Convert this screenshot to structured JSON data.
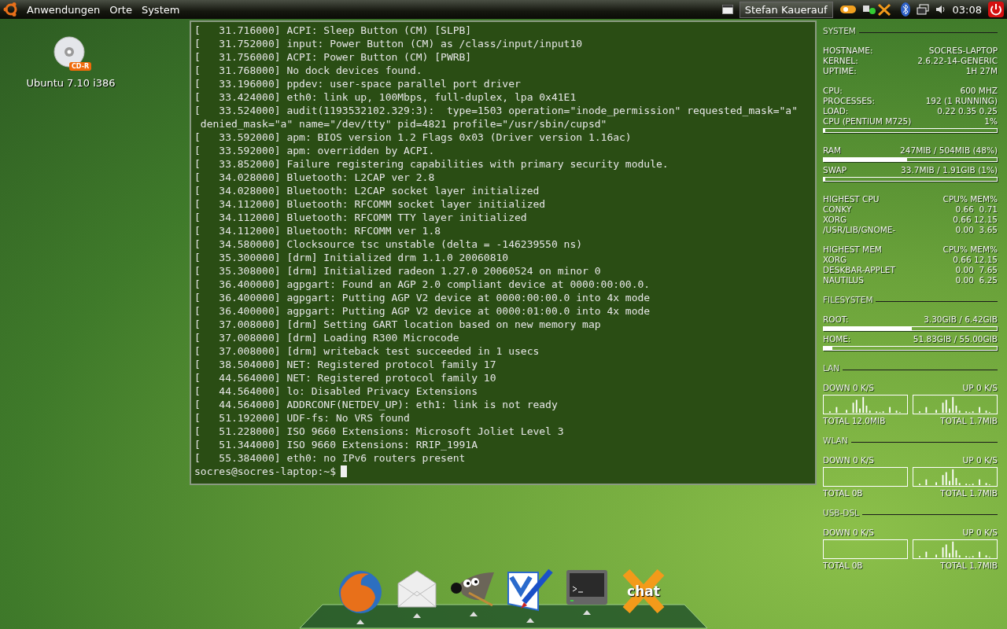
{
  "top_panel": {
    "menus": [
      "Anwendungen",
      "Orte",
      "System"
    ],
    "user": "Stefan Kauerauf",
    "clock": "03:08"
  },
  "desktop_icons": [
    {
      "label": "Ubuntu 7.10 i386",
      "badge": "CD-R"
    }
  ],
  "terminal": {
    "lines": [
      "[   31.716000] ACPI: Sleep Button (CM) [SLPB]",
      "[   31.752000] input: Power Button (CM) as /class/input/input10",
      "[   31.756000] ACPI: Power Button (CM) [PWRB]",
      "[   31.768000] No dock devices found.",
      "[   33.196000] ppdev: user-space parallel port driver",
      "[   33.424000] eth0: link up, 100Mbps, full-duplex, lpa 0x41E1",
      "[   33.524000] audit(1193532102.329:3):  type=1503 operation=\"inode_permission\" requested_mask=\"a\"",
      " denied_mask=\"a\" name=\"/dev/tty\" pid=4821 profile=\"/usr/sbin/cupsd\"",
      "[   33.592000] apm: BIOS version 1.2 Flags 0x03 (Driver version 1.16ac)",
      "[   33.592000] apm: overridden by ACPI.",
      "[   33.852000] Failure registering capabilities with primary security module.",
      "[   34.028000] Bluetooth: L2CAP ver 2.8",
      "[   34.028000] Bluetooth: L2CAP socket layer initialized",
      "[   34.112000] Bluetooth: RFCOMM socket layer initialized",
      "[   34.112000] Bluetooth: RFCOMM TTY layer initialized",
      "[   34.112000] Bluetooth: RFCOMM ver 1.8",
      "[   34.580000] Clocksource tsc unstable (delta = -146239550 ns)",
      "[   35.300000] [drm] Initialized drm 1.1.0 20060810",
      "[   35.308000] [drm] Initialized radeon 1.27.0 20060524 on minor 0",
      "[   36.400000] agpgart: Found an AGP 2.0 compliant device at 0000:00:00.0.",
      "[   36.400000] agpgart: Putting AGP V2 device at 0000:00:00.0 into 4x mode",
      "[   36.400000] agpgart: Putting AGP V2 device at 0000:01:00.0 into 4x mode",
      "[   37.008000] [drm] Setting GART location based on new memory map",
      "[   37.008000] [drm] Loading R300 Microcode",
      "[   37.008000] [drm] writeback test succeeded in 1 usecs",
      "[   38.504000] NET: Registered protocol family 17",
      "[   44.564000] NET: Registered protocol family 10",
      "[   44.564000] lo: Disabled Privacy Extensions",
      "[   44.564000] ADDRCONF(NETDEV_UP): eth1: link is not ready",
      "[   51.192000] UDF-fs: No VRS found",
      "[   51.228000] ISO 9660 Extensions: Microsoft Joliet Level 3",
      "[   51.344000] ISO 9660 Extensions: RRIP_1991A",
      "[   55.384000] eth0: no IPv6 routers present"
    ],
    "prompt": "socres@socres-laptop:~$"
  },
  "conky": [
    {
      "kind": "stats",
      "title": "SYSTEM",
      "groups": [
        [
          {
            "kind": "row",
            "label": "HOSTNAME:",
            "value": "SOCRES-LAPTOP"
          },
          {
            "kind": "row",
            "label": "KERNEL:",
            "value": "2.6.22-14-GENERIC"
          },
          {
            "kind": "row",
            "label": "UPTIME:",
            "value": "1H 27M"
          }
        ],
        [
          {
            "kind": "row",
            "label": "CPU:",
            "value": "600 MHZ"
          },
          {
            "kind": "row",
            "label": "PROCESSES:",
            "value": "192 (1 RUNNING)"
          },
          {
            "kind": "row",
            "label": "LOAD:",
            "value": "0.22 0.35 0.25"
          },
          {
            "kind": "row",
            "label": "CPU (PENTIUM M725)",
            "value": "1%"
          },
          {
            "kind": "bar",
            "level": 0.01
          }
        ],
        [
          {
            "kind": "row",
            "label": "RAM",
            "value": "247MIB / 504MIB (48%)"
          },
          {
            "kind": "bar",
            "level": 0.48
          },
          {
            "kind": "row",
            "label": "SWAP",
            "value": "33.7MIB / 1.91GIB (1%)"
          },
          {
            "kind": "bar",
            "level": 0.01
          }
        ],
        [
          {
            "kind": "row",
            "label": "HIGHEST CPU",
            "value": "CPU% MEM%"
          },
          {
            "kind": "row",
            "label": "CONKY",
            "value": "0.66  0.71"
          },
          {
            "kind": "row",
            "label": "XORG",
            "value": "0.66 12.15"
          },
          {
            "kind": "row",
            "label": "/USR/LIB/GNOME-",
            "value": "0.00  3.65"
          }
        ],
        [
          {
            "kind": "row",
            "label": "HIGHEST MEM",
            "value": "CPU% MEM%"
          },
          {
            "kind": "row",
            "label": "XORG",
            "value": "0.66 12.15"
          },
          {
            "kind": "row",
            "label": "DESKBAR-APPLET",
            "value": "0.00  7.65"
          },
          {
            "kind": "row",
            "label": "NAUTILUS",
            "value": "0.00  6.25"
          }
        ]
      ]
    },
    {
      "kind": "stats",
      "title": "FILESYSTEM",
      "groups": [
        [
          {
            "kind": "row",
            "label": "ROOT:",
            "value": "3.30GIB / 6.42GIB"
          },
          {
            "kind": "bar",
            "level": 0.51
          },
          {
            "kind": "row",
            "label": "HOME:",
            "value": "51.83GIB / 55.00GIB"
          },
          {
            "kind": "bar",
            "level": 0.05
          }
        ]
      ]
    },
    {
      "kind": "network",
      "title": "LAN",
      "down": "DOWN 0 K/S",
      "up": "UP 0 K/S",
      "down_active": true,
      "up_active": true,
      "down_total": "TOTAL 12.0MIB",
      "up_total": "TOTAL 1.7MIB"
    },
    {
      "kind": "network",
      "title": "WLAN",
      "down": "DOWN 0 K/S",
      "up": "UP 0 K/S",
      "down_active": false,
      "up_active": true,
      "down_total": "TOTAL 0B",
      "up_total": "TOTAL 1.7MIB"
    },
    {
      "kind": "network",
      "title": "USB-DSL",
      "down": "DOWN 0 K/S",
      "up": "UP 0 K/S",
      "down_active": false,
      "up_active": true,
      "down_total": "TOTAL 0B",
      "up_total": "TOTAL 1.7MIB"
    }
  ],
  "dock": [
    {
      "kind": "browser",
      "running": true
    },
    {
      "kind": "mail",
      "running": true
    },
    {
      "kind": "gimp",
      "running": true
    },
    {
      "kind": "editor",
      "running": true
    },
    {
      "kind": "terminal",
      "running": true
    },
    {
      "kind": "chat",
      "running": false,
      "label": "chat"
    }
  ]
}
